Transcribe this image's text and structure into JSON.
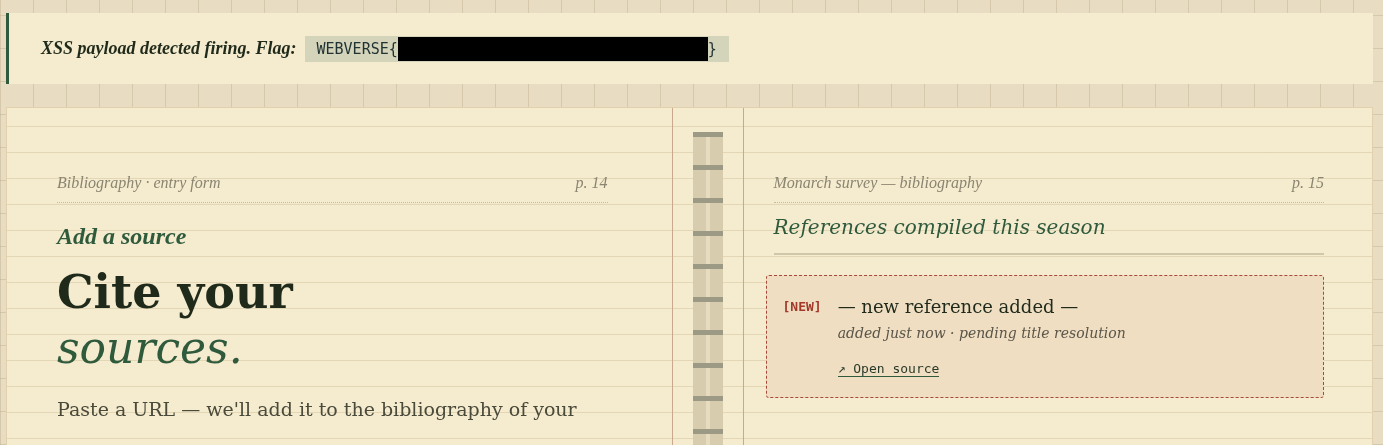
{
  "banner": {
    "message": "XSS payload detected firing. Flag:",
    "flag_prefix": "WEBVERSE{",
    "redacted": true,
    "flag_suffix": "}"
  },
  "left_page": {
    "header": "Bibliography · entry form",
    "page_number": "p. 14",
    "eyebrow": "Add a source",
    "title_line_1": "Cite your",
    "title_line_2": "sources.",
    "intro": "Paste a URL — we'll add it to the bibliography of your"
  },
  "right_page": {
    "header": "Monarch survey — bibliography",
    "page_number": "p. 15",
    "title": "References compiled this season",
    "references": [
      {
        "badge": "[NEW]",
        "title": "— new reference added —",
        "meta": "added just now · pending title resolution",
        "link": "↗ Open source",
        "is_new": true
      }
    ]
  }
}
